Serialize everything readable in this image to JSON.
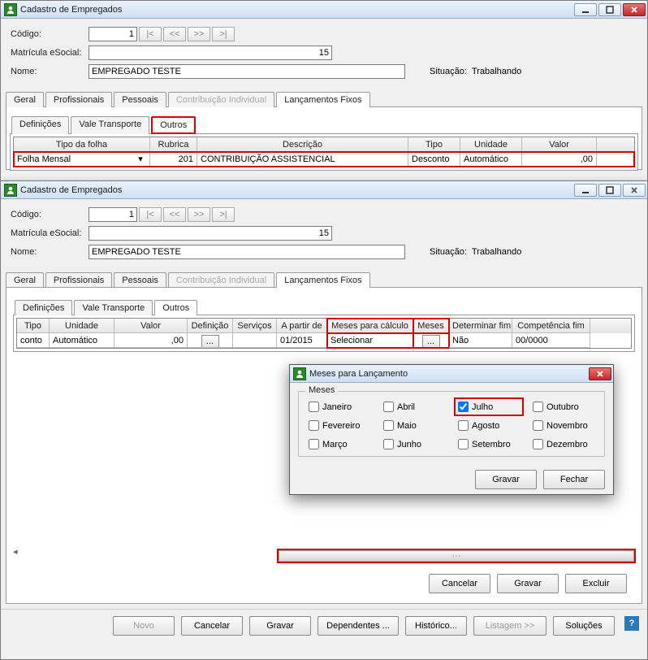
{
  "win1": {
    "title": "Cadastro de Empregados",
    "labels": {
      "codigo": "Código:",
      "matricula": "Matrícula eSocial:",
      "nome": "Nome:",
      "situacao_lbl": "Situação:",
      "situacao_val": "Trabalhando"
    },
    "fields": {
      "codigo": "1",
      "matricula": "15",
      "nome": "EMPREGADO TESTE"
    },
    "nav": {
      "first": "|<",
      "prev": "<<",
      "next": ">>",
      "last": ">|"
    },
    "tabs": {
      "geral": "Geral",
      "profissionais": "Profissionais",
      "pessoais": "Pessoais",
      "contrib": "Contribuição Individual",
      "lanc": "Lançamentos Fixos"
    },
    "subtabs": {
      "definicoes": "Definições",
      "vale": "Vale Transporte",
      "outros": "Outros"
    },
    "grid": {
      "headers": {
        "tipo_folha": "Tipo da folha",
        "rubrica": "Rubrica",
        "descricao": "Descrição",
        "tipo": "Tipo",
        "unidade": "Unidade",
        "valor": "Valor"
      },
      "row": {
        "tipo_folha": "Folha Mensal",
        "rubrica": "201",
        "descricao": "CONTRIBUIÇÃO ASSISTENCIAL",
        "tipo": "Desconto",
        "unidade": "Automático",
        "valor": ",00"
      }
    }
  },
  "win2": {
    "title": "Cadastro de Empregados",
    "labels": {
      "codigo": "Código:",
      "matricula": "Matrícula eSocial:",
      "nome": "Nome:",
      "situacao_lbl": "Situação:",
      "situacao_val": "Trabalhando"
    },
    "fields": {
      "codigo": "1",
      "matricula": "15",
      "nome": "EMPREGADO TESTE"
    },
    "nav": {
      "first": "|<",
      "prev": "<<",
      "next": ">>",
      "last": ">|"
    },
    "tabs": {
      "geral": "Geral",
      "profissionais": "Profissionais",
      "pessoais": "Pessoais",
      "contrib": "Contribuição Individual",
      "lanc": "Lançamentos Fixos"
    },
    "subtabs": {
      "definicoes": "Definições",
      "vale": "Vale Transporte",
      "outros": "Outros"
    },
    "grid2": {
      "headers": {
        "tipo": "Tipo",
        "unidade": "Unidade",
        "valor": "Valor",
        "definicao": "Definição",
        "servicos": "Serviços",
        "apartir": "A partir de",
        "meses_calc": "Meses para cálculo",
        "meses": "Meses",
        "determinar": "Determinar fim",
        "competencia": "Competência fim"
      },
      "row": {
        "tipo": "conto",
        "unidade": "Automático",
        "valor": ",00",
        "definicao": "...",
        "servicos": "",
        "apartir": "01/2015",
        "meses_calc": "Selecionar",
        "meses": "...",
        "determinar": "Não",
        "competencia": "00/0000"
      }
    },
    "buttons": {
      "cancelar": "Cancelar",
      "gravar": "Gravar",
      "excluir": "Excluir"
    },
    "scroll_thumb": "···"
  },
  "dialog": {
    "title": "Meses para Lançamento",
    "group": "Meses",
    "months": {
      "jan": "Janeiro",
      "fev": "Fevereiro",
      "mar": "Março",
      "abr": "Abril",
      "mai": "Maio",
      "jun": "Junho",
      "jul": "Julho",
      "ago": "Agosto",
      "set": "Setembro",
      "out": "Outubro",
      "nov": "Novembro",
      "dez": "Dezembro"
    },
    "checked": "jul",
    "buttons": {
      "gravar": "Gravar",
      "fechar": "Fechar"
    }
  },
  "bottombar": {
    "novo": "Novo",
    "cancelar": "Cancelar",
    "gravar": "Gravar",
    "dependentes": "Dependentes ...",
    "historico": "Histórico...",
    "listagem": "Listagem >>",
    "solucoes": "Soluções"
  }
}
